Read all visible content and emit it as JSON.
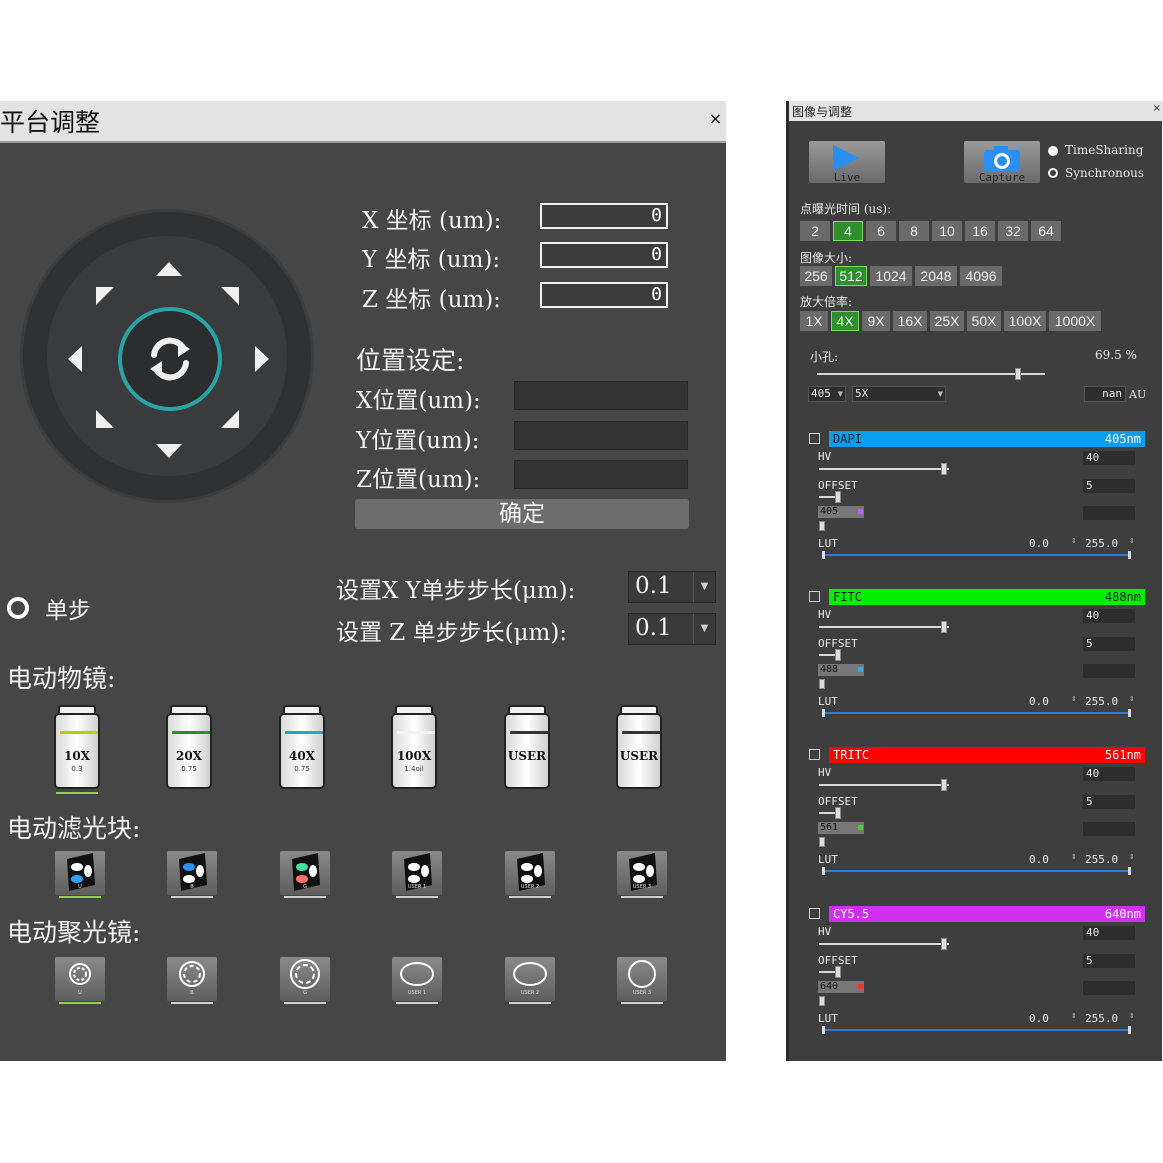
{
  "stage": {
    "title": "平台调整",
    "close": "×",
    "coords": [
      {
        "label": "X 坐标 (um):",
        "value": "0"
      },
      {
        "label": "Y 坐标 (um):",
        "value": "0"
      },
      {
        "label": "Z 坐标 (um):",
        "value": "0"
      }
    ],
    "position_title": "位置设定:",
    "positions": [
      {
        "label": "X位置(um):",
        "value": ""
      },
      {
        "label": "Y位置(um):",
        "value": ""
      },
      {
        "label": "Z位置(um):",
        "value": ""
      }
    ],
    "confirm_label": "确定",
    "single_step_label": "单步",
    "xy_step_label": "设置X Y单步步长(μm):",
    "xy_step_value": "0.1",
    "z_step_label": "设置 Z 单步步长(μm):",
    "z_step_value": "0.1",
    "objective_title": "电动物镜:",
    "objectives": [
      {
        "mag": "10X",
        "na": "0.3",
        "stripe": "#c8c800",
        "selected": true
      },
      {
        "mag": "20X",
        "na": "0.75",
        "stripe": "#2f8f2f",
        "selected": false
      },
      {
        "mag": "40X",
        "na": "0.75",
        "stripe": "#2aa3c6",
        "selected": false
      },
      {
        "mag": "100X",
        "na": "1.4oil",
        "stripe": "#f2f2f2",
        "selected": false
      },
      {
        "mag": "USER",
        "na": "",
        "stripe": "#333333",
        "selected": false
      },
      {
        "mag": "USER",
        "na": "",
        "stripe": "#333333",
        "selected": false
      }
    ],
    "filter_title": "电动滤光块:",
    "filters": [
      {
        "tag": "U",
        "selected": true
      },
      {
        "tag": "B",
        "selected": false
      },
      {
        "tag": "G",
        "selected": false
      },
      {
        "tag": "USER 1",
        "selected": false
      },
      {
        "tag": "USER 2",
        "selected": false
      },
      {
        "tag": "USER 3",
        "selected": false
      }
    ],
    "condenser_title": "电动聚光镜:",
    "condensers": [
      {
        "tag": "U",
        "selected": true
      },
      {
        "tag": "B",
        "selected": false
      },
      {
        "tag": "G",
        "selected": false
      },
      {
        "tag": "USER 1",
        "selected": false
      },
      {
        "tag": "USER 2",
        "selected": false
      },
      {
        "tag": "USER 3",
        "selected": false
      }
    ]
  },
  "image": {
    "title": "图像与调整",
    "close": "×",
    "live_label": "Live",
    "capture_label": "Capture",
    "modes": [
      {
        "label": "TimeSharing",
        "selected": true
      },
      {
        "label": "Synchronous",
        "selected": false
      }
    ],
    "exposure_title": "点曝光时间 (us):",
    "exposure_options": [
      "2",
      "4",
      "6",
      "8",
      "10",
      "16",
      "32",
      "64"
    ],
    "exposure_selected": "4",
    "size_title": "图像大小:",
    "size_options": [
      "256",
      "512",
      "1024",
      "2048",
      "4096"
    ],
    "size_selected": "512",
    "zoom_title": "放大倍率:",
    "zoom_options": [
      "1X",
      "4X",
      "9X",
      "16X",
      "25X",
      "50X",
      "100X",
      "1000X"
    ],
    "zoom_selected": "4X",
    "pinhole_label": "小孔:",
    "pinhole_value": "69.5 %",
    "pinhole_fraction": 0.87,
    "pinhole_wave": "405",
    "pinhole_obj": "5X",
    "pinhole_au_value": "nan",
    "pinhole_au_unit": "AU",
    "channels": [
      {
        "name": "DAPI",
        "nm": "405nm",
        "color": "#0a9ef0",
        "text_color": "#1a1a1a",
        "nm_color": "#ffffff",
        "hv_label": "HV",
        "hv": "40",
        "offset_label": "OFFSET",
        "offset": "5",
        "wl": "405",
        "wl_mark": "#b060ff",
        "lut_label": "LUT",
        "lut_min": "0.0",
        "lut_max": "255.0"
      },
      {
        "name": "FITC",
        "nm": "488nm",
        "color": "#00f000",
        "text_color": "#1a1a1a",
        "nm_color": "#1a1a1a",
        "hv_label": "HV",
        "hv": "40",
        "offset_label": "OFFSET",
        "offset": "5",
        "wl": "488",
        "wl_mark": "#40a0ff",
        "lut_label": "LUT",
        "lut_min": "0.0",
        "lut_max": "255.0"
      },
      {
        "name": "TRITC",
        "nm": "561nm",
        "color": "#ff0000",
        "text_color": "#ffffff",
        "nm_color": "#ffffff",
        "hv_label": "HV",
        "hv": "40",
        "offset_label": "OFFSET",
        "offset": "5",
        "wl": "561",
        "wl_mark": "#40d040",
        "lut_label": "LUT",
        "lut_min": "0.0",
        "lut_max": "255.0"
      },
      {
        "name": "CY5.5",
        "nm": "640nm",
        "color": "#d030f0",
        "text_color": "#ffffff",
        "nm_color": "#ffffff",
        "hv_label": "HV",
        "hv": "40",
        "offset_label": "OFFSET",
        "offset": "5",
        "wl": "640",
        "wl_mark": "#ff3030",
        "lut_label": "LUT",
        "lut_min": "0.0",
        "lut_max": "255.0"
      }
    ]
  }
}
